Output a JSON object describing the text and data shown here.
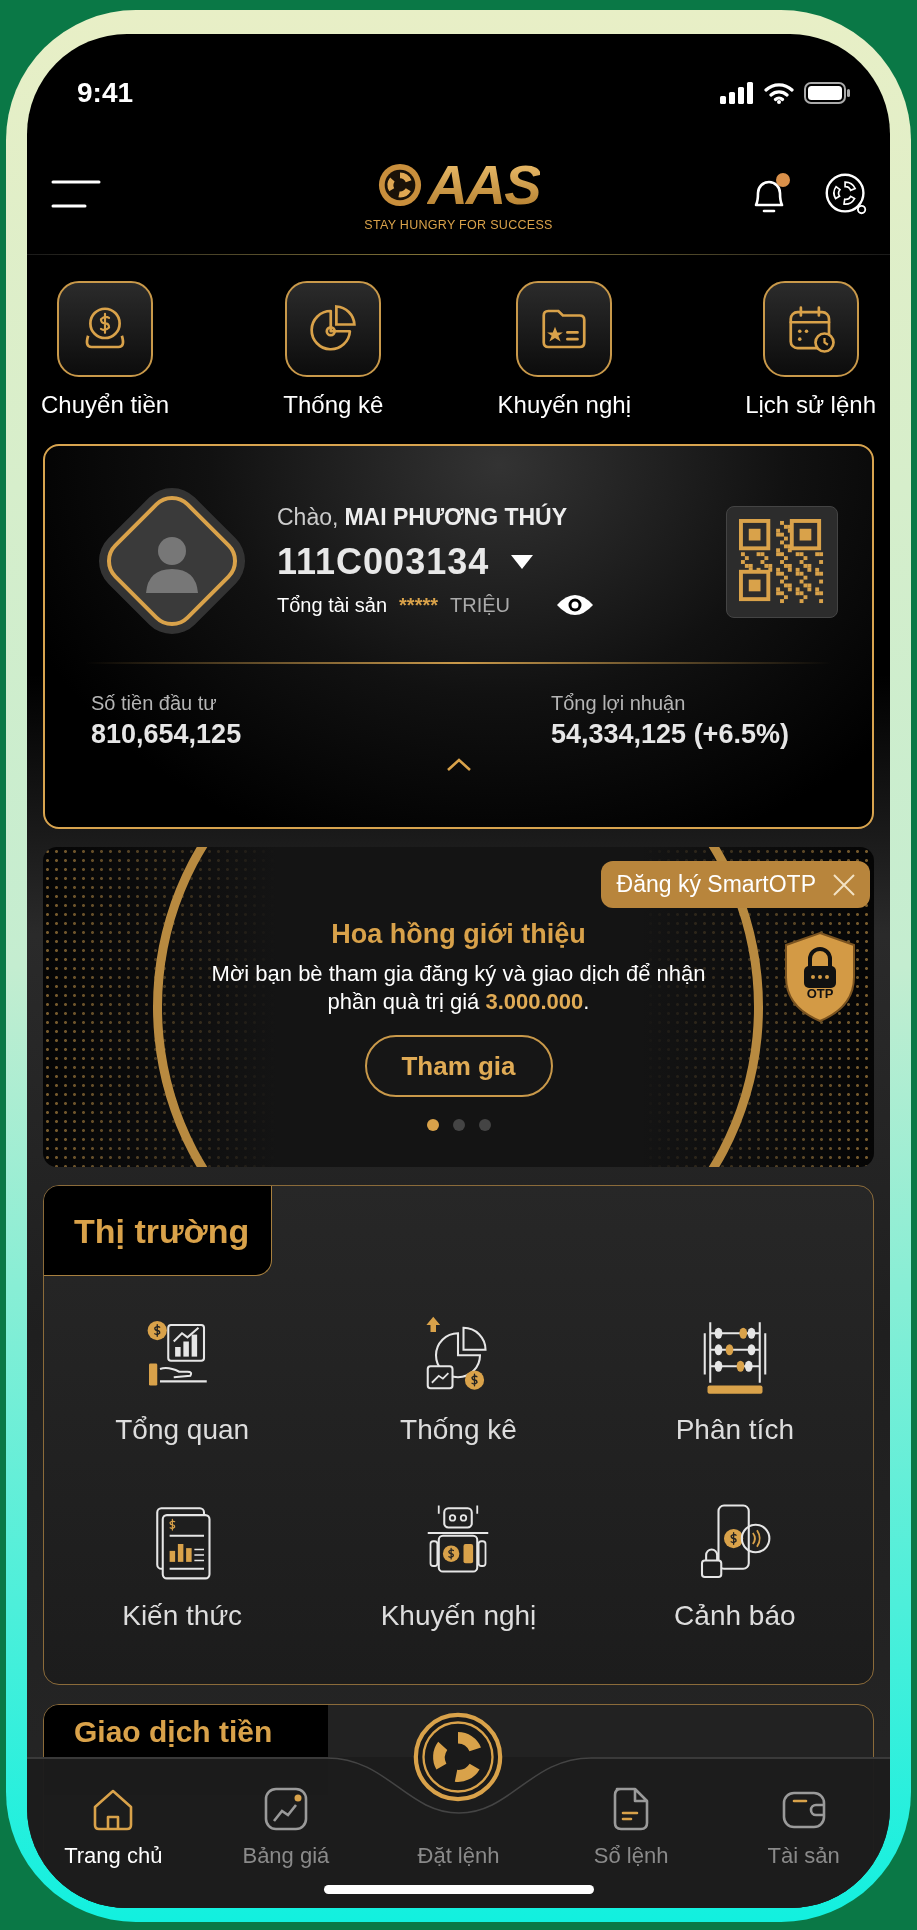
{
  "status_bar": {
    "time": "9:41"
  },
  "header": {
    "logo": "AAS",
    "tagline": "STAY HUNGRY FOR SUCCESS",
    "notification_unread": true
  },
  "quick_actions": [
    {
      "label": "Chuyển tiền"
    },
    {
      "label": "Thống kê"
    },
    {
      "label": "Khuyến nghị"
    },
    {
      "label": "Lịch sử lệnh"
    }
  ],
  "account": {
    "greeting": "Chào,",
    "name": "MAI PHƯƠNG THÚY",
    "account_no": "111C003134",
    "assets_label": "Tổng tài sản",
    "assets_value": "*****",
    "assets_unit": "TRIỆU",
    "invest_label": "Số tiền đầu tư",
    "invest_value": "810,654,125",
    "profit_label": "Tổng lợi nhuận",
    "profit_value": "54,334,125 (+6.5%)"
  },
  "banner": {
    "title": "Hoa hồng giới thiệu",
    "text": "Mời bạn bè tham gia đăng ký và giao dịch để nhận phần quà trị giá **3.000.000**.",
    "button": "Tham gia",
    "dots": [
      {
        "selected": true
      },
      {
        "selected": false
      },
      {
        "selected": false
      }
    ]
  },
  "smartotp_tip": {
    "text": "Đăng ký SmartOTP",
    "badge": "OTP"
  },
  "market": {
    "title": "Thị trường",
    "items": [
      {
        "label": "Tổng quan"
      },
      {
        "label": "Thống kê"
      },
      {
        "label": "Phân tích"
      },
      {
        "label": "Kiến thức"
      },
      {
        "label": "Khuyến nghị"
      },
      {
        "label": "Cảnh báo"
      }
    ]
  },
  "cash_section": {
    "title": "Giao dịch tiền"
  },
  "bottom_nav": [
    {
      "label": "Trang chủ",
      "selected": true
    },
    {
      "label": "Bảng giá",
      "selected": false
    },
    {
      "label": "Đặt lệnh",
      "selected": false
    },
    {
      "label": "Sổ lệnh",
      "selected": false
    },
    {
      "label": "Tài sản",
      "selected": false
    }
  ]
}
